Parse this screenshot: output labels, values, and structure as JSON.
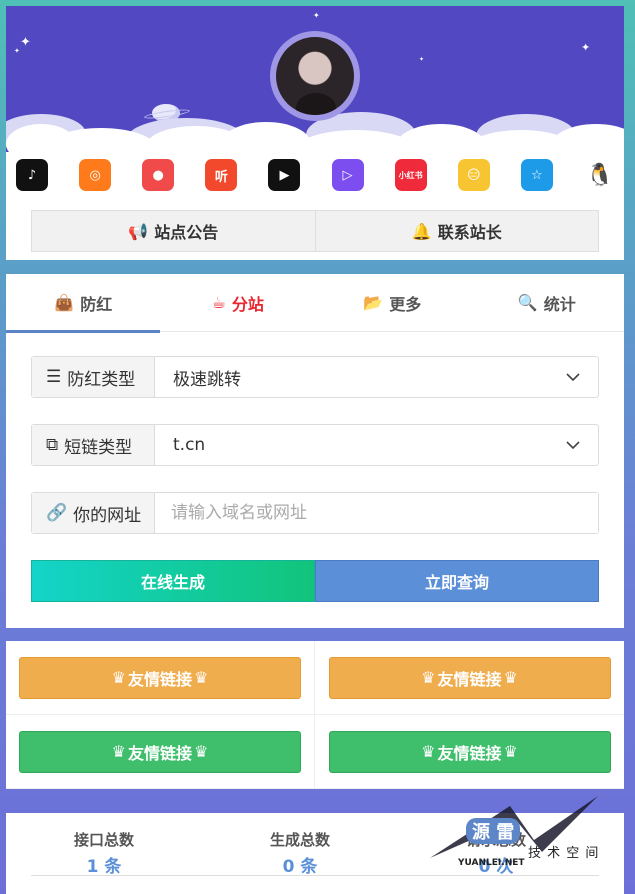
{
  "header": {
    "apps": [
      {
        "icon": "tiktok-icon",
        "glyph": "♪",
        "color": "#111111"
      },
      {
        "icon": "kuaishou-icon",
        "glyph": "◎",
        "color": "#ff7a1a"
      },
      {
        "icon": "color-search-icon",
        "glyph": "●",
        "color": "#f04a4a"
      },
      {
        "icon": "ting-icon",
        "glyph": "听",
        "color": "#f2492c"
      },
      {
        "icon": "video-play-icon",
        "glyph": "▶",
        "color": "#111111"
      },
      {
        "icon": "media-play-icon",
        "glyph": "▷",
        "color": "#7c4ef0"
      },
      {
        "icon": "xiaohongshu-icon",
        "glyph": "小红书",
        "color": "#ef2b3b"
      },
      {
        "icon": "emoji-app-icon",
        "glyph": "😑",
        "color": "#f7c531"
      },
      {
        "icon": "qzone-icon",
        "glyph": "☆",
        "color": "#1e9be8"
      },
      {
        "icon": "qq-penguin-icon",
        "glyph": "🐧",
        "color": "#ffffff"
      }
    ],
    "notice_label": "站点公告",
    "contact_label": "联系站长"
  },
  "tabs": [
    {
      "label": "防红",
      "icon": "bag-icon",
      "active": false
    },
    {
      "label": "分站",
      "icon": "cup-icon",
      "active": true
    },
    {
      "label": "更多",
      "icon": "folder-icon",
      "active": false
    },
    {
      "label": "统计",
      "icon": "search-icon",
      "active": false
    }
  ],
  "form": {
    "type_label": "防红类型",
    "type_value": "极速跳转",
    "short_label": "短链类型",
    "short_value": "t.cn",
    "url_label": "你的网址",
    "url_placeholder": "请输入域名或网址",
    "generate_label": "在线生成",
    "query_label": "立即查询"
  },
  "links": [
    {
      "label": "友情链接",
      "color": "#f0ad4e"
    },
    {
      "label": "友情链接",
      "color": "#f0ad4e"
    },
    {
      "label": "友情链接",
      "color": "#3fbe6c"
    },
    {
      "label": "友情链接",
      "color": "#3fbe6c"
    }
  ],
  "stats": [
    {
      "label": "接口总数",
      "value": "1 条"
    },
    {
      "label": "生成总数",
      "value": "0 条"
    },
    {
      "label": "请求总数",
      "value": "0 次"
    }
  ],
  "watermark": {
    "line1": "源 雷",
    "line2": "技 术 空 间",
    "line3": "YUANLEI.NET"
  }
}
